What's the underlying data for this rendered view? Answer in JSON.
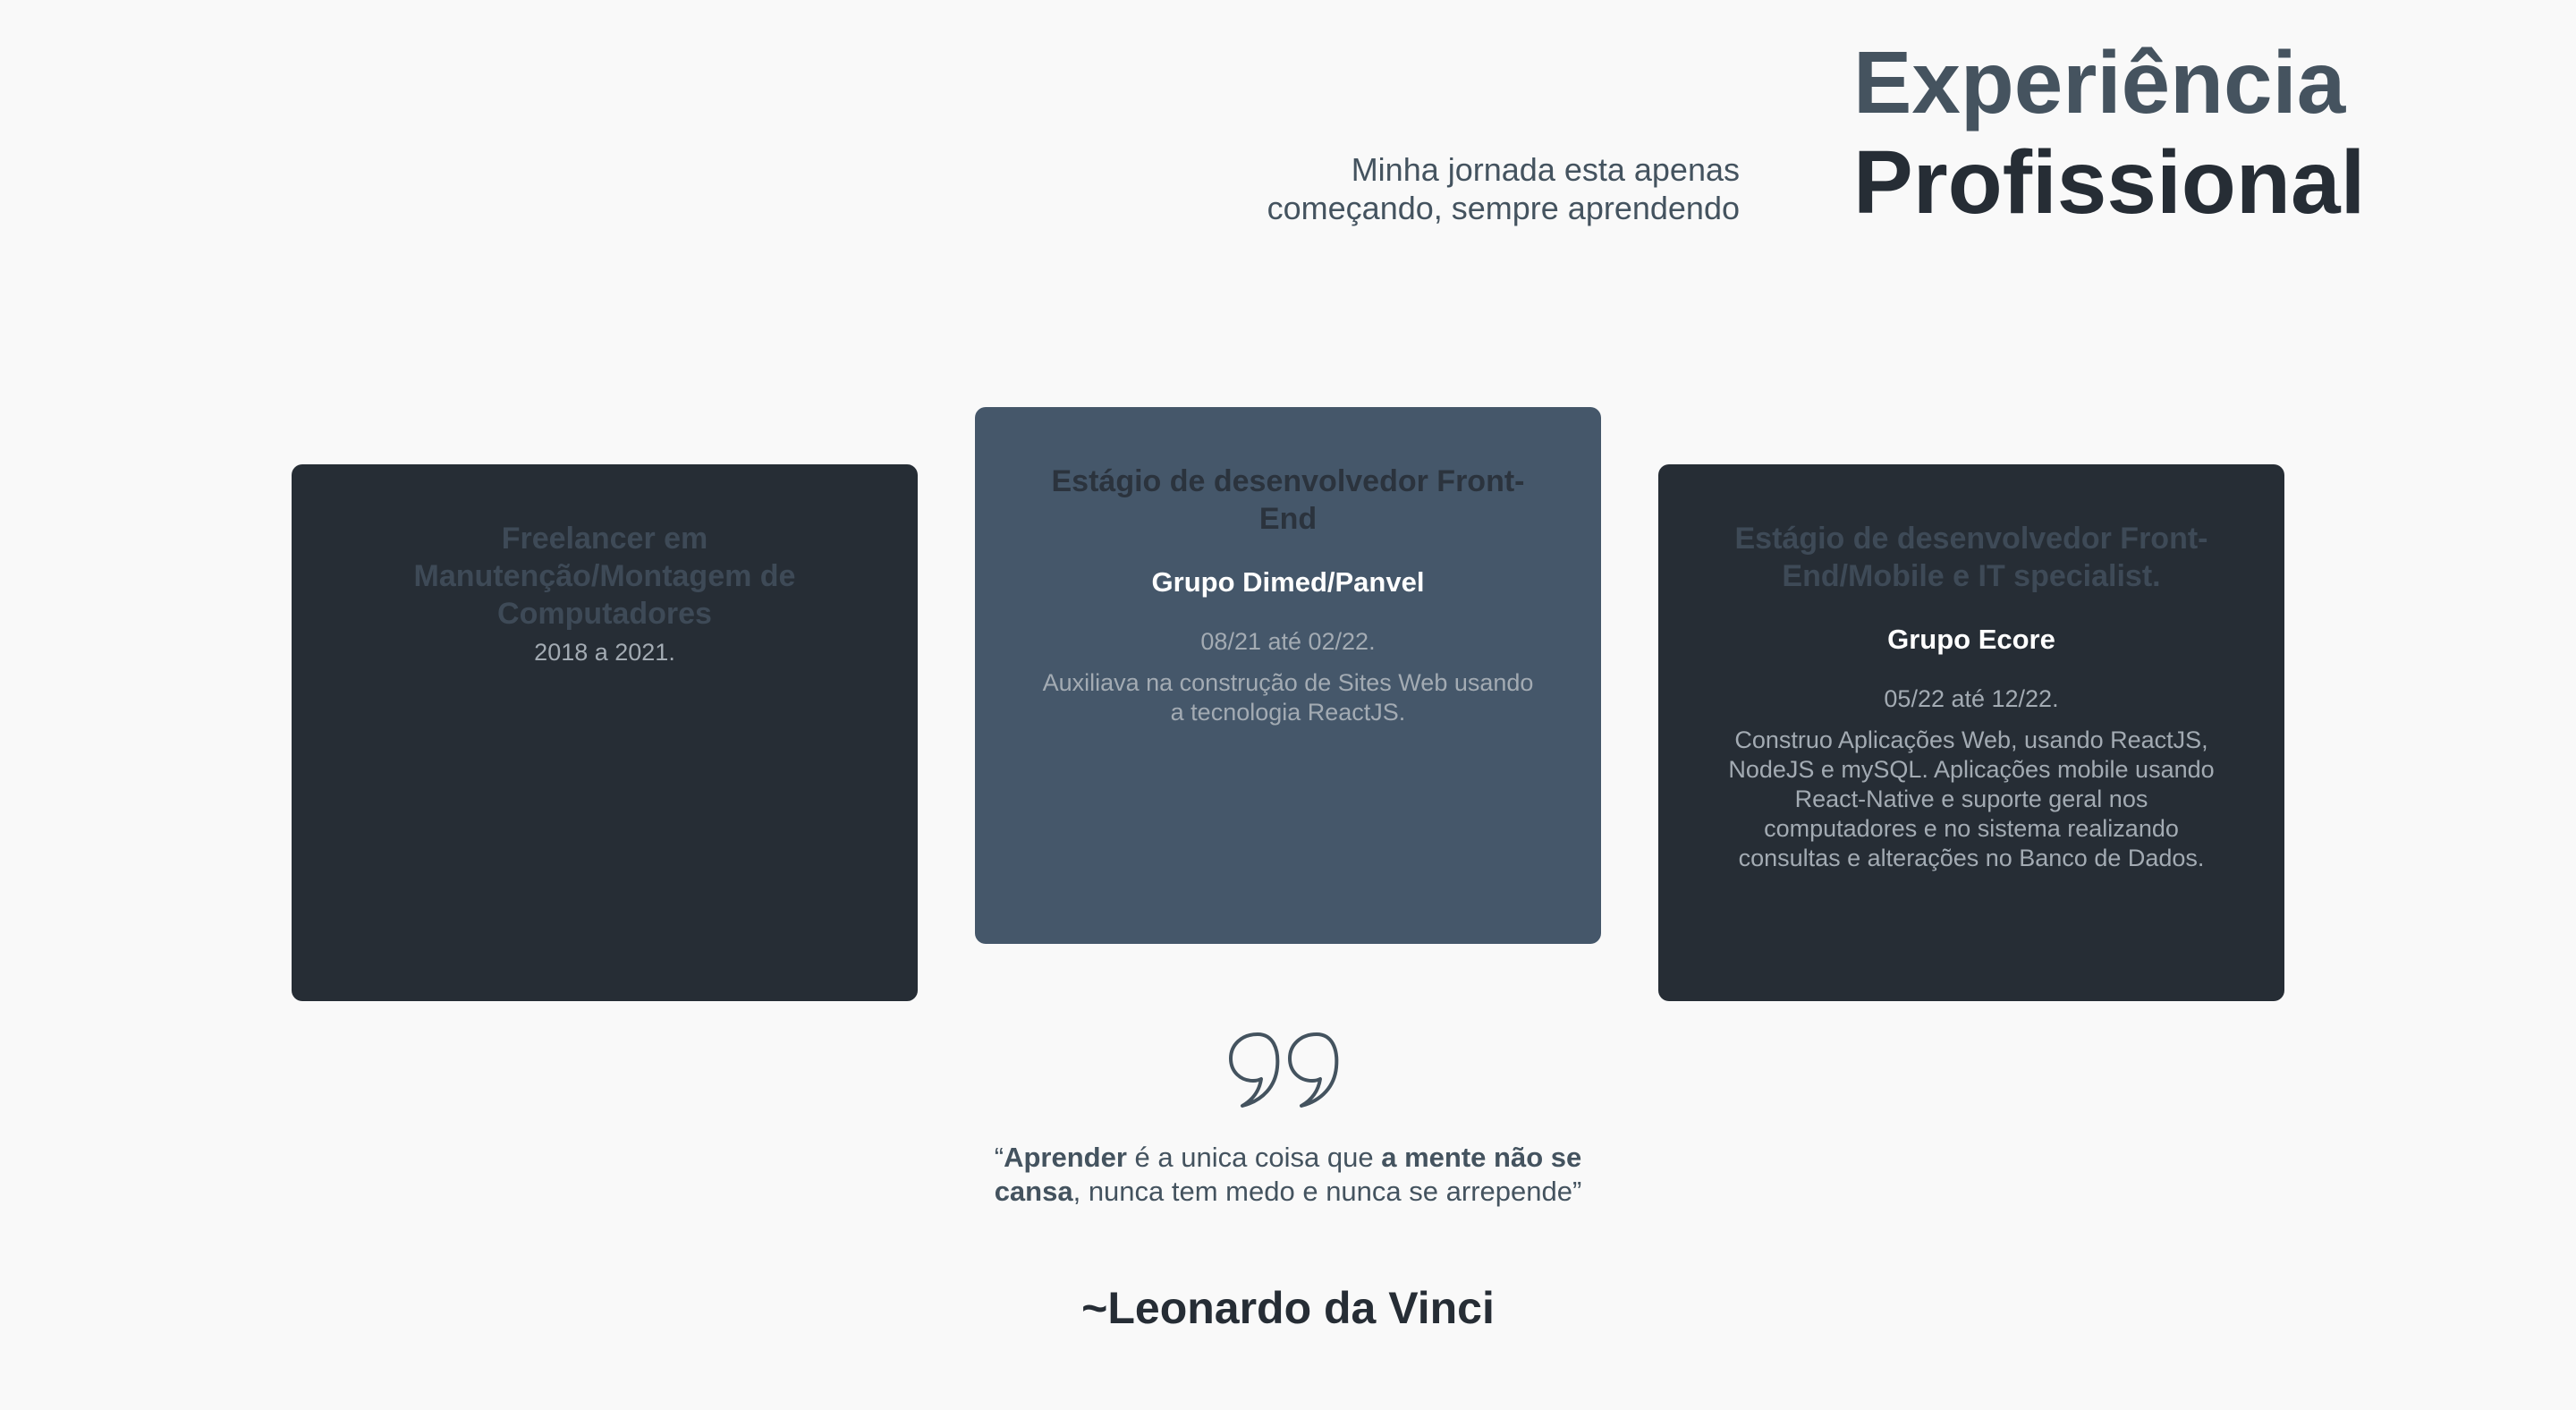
{
  "header": {
    "subtitle_line1": "Minha jornada esta apenas",
    "subtitle_line2": "começando, sempre aprendendo",
    "title_line1": "Experiência",
    "title_line2": "Profissional"
  },
  "cards": [
    {
      "title": "Freelancer em Manutenção/Montagem de Computadores",
      "company": "",
      "period": "2018 a 2021.",
      "description": ""
    },
    {
      "title": "Estágio de desenvolvedor Front-End",
      "company": "Grupo Dimed/Panvel",
      "period": "08/21 até 02/22.",
      "description": "Auxiliava na construção de Sites Web usando a tecnologia ReactJS."
    },
    {
      "title": "Estágio de desenvolvedor Front-End/Mobile e IT specialist.",
      "company": "Grupo Ecore",
      "period": "05/22 até 12/22.",
      "description": "Construo Aplicações Web, usando ReactJS, NodeJS e mySQL. Aplicações mobile usando React-Native e suporte geral nos computadores e no sistema realizando consultas e alterações no Banco de Dados."
    }
  ],
  "quote": {
    "icon": "quote-icon",
    "open_mark": "“",
    "word1": "Aprender",
    "text1": " é a unica coisa que ",
    "bold2": "a mente não se cansa",
    "text2": ", nunca tem medo e nunca se arrepende",
    "close_mark": "”",
    "author": "~Leonardo da Vinci"
  },
  "colors": {
    "background": "#f9f9f9",
    "card_dark": "#262d35",
    "card_active": "#45576a",
    "heading_dark": "#262d35",
    "heading_accent": "#45535f"
  }
}
